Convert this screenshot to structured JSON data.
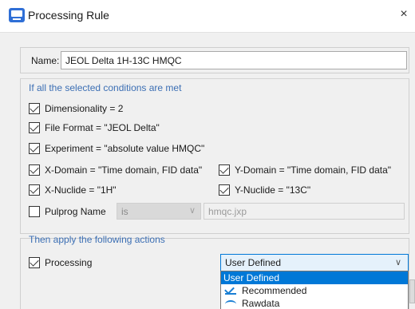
{
  "window": {
    "title": "Processing Rule",
    "close_glyph": "×",
    "icon": "app-window-icon"
  },
  "name": {
    "label": "Name:",
    "value": "JEOL Delta 1H-13C HMQC"
  },
  "conditions": {
    "heading": "If all the selected conditions are met",
    "items": [
      {
        "label": "Dimensionality = 2",
        "checked": true
      },
      {
        "label": "File Format = \"JEOL Delta\"",
        "checked": true
      },
      {
        "label": "Experiment = \"absolute value HMQC\"",
        "checked": true
      },
      {
        "label": "X-Domain = \"Time domain, FID data\"",
        "checked": true
      },
      {
        "label": "Y-Domain = \"Time domain, FID data\"",
        "checked": true
      },
      {
        "label": "X-Nuclide = \"1H\"",
        "checked": true
      },
      {
        "label": "Y-Nuclide = \"13C\"",
        "checked": true
      }
    ],
    "pulprog": {
      "label": "Pulprog Name",
      "checked": false,
      "operator": "is",
      "value": "hmqc.jxp"
    }
  },
  "actions": {
    "heading": "Then apply the following actions",
    "processing": {
      "label": "Processing",
      "checked": true,
      "selected": "User Defined"
    },
    "options": [
      "User Defined",
      "Recommended",
      "Rawdata"
    ]
  },
  "colors": {
    "accent": "#0078d7",
    "section_heading": "#3c6fb4"
  }
}
